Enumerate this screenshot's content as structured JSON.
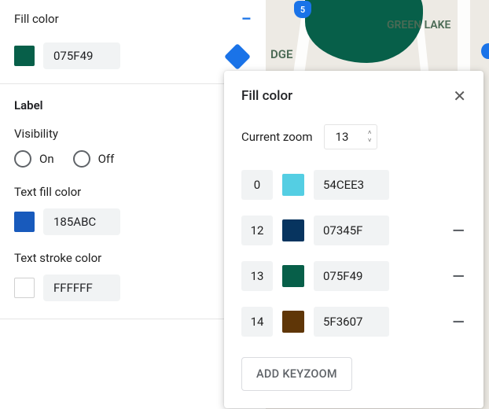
{
  "panel": {
    "fill_color": {
      "title": "Fill color",
      "hex": "075F49",
      "swatch": "#075F49"
    },
    "diamond_color": "#1a73e8",
    "label_section": {
      "title": "Label",
      "visibility": {
        "label": "Visibility",
        "on": "On",
        "off": "Off"
      },
      "text_fill": {
        "label": "Text fill color",
        "hex": "185ABC",
        "swatch": "#185ABC"
      },
      "text_stroke": {
        "label": "Text stroke color",
        "hex": "FFFFFF",
        "swatch": "#FFFFFF"
      }
    }
  },
  "map": {
    "labels": {
      "green_lake": "GREEN LAKE",
      "dge": "DGE"
    },
    "shield": "5"
  },
  "popover": {
    "title": "Fill color",
    "zoom_label": "Current zoom",
    "zoom_value": "13",
    "stops": [
      {
        "zoom": "0",
        "hex": "54CEE3",
        "swatch": "#54CEE3",
        "removable": false
      },
      {
        "zoom": "12",
        "hex": "07345F",
        "swatch": "#07345F",
        "removable": true
      },
      {
        "zoom": "13",
        "hex": "075F49",
        "swatch": "#075F49",
        "removable": true
      },
      {
        "zoom": "14",
        "hex": "5F3607",
        "swatch": "#5F3607",
        "removable": true
      }
    ],
    "add_label": "ADD KEYZOOM"
  },
  "colors": {
    "stop0": "#54CEE3",
    "stop1": "#07345F",
    "stop2": "#075F49",
    "stop3": "#5F3607"
  }
}
